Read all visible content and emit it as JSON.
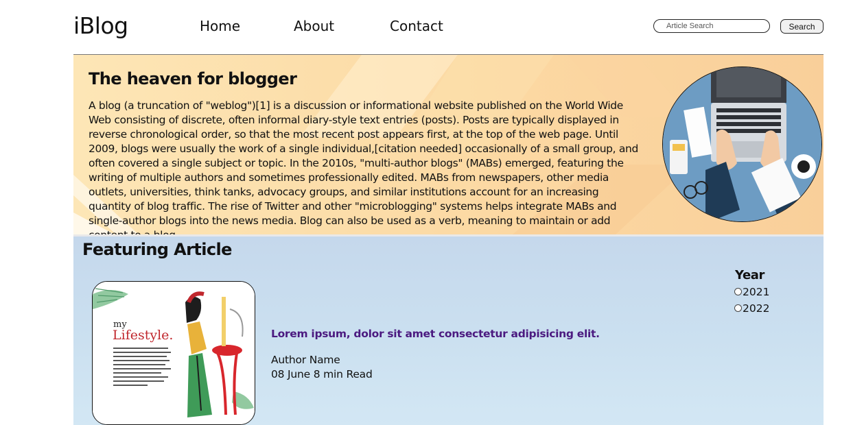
{
  "nav": {
    "logo": "iBlog",
    "links": [
      "Home",
      "About",
      "Contact"
    ],
    "search_placeholder": "Article Search",
    "search_button": "Search"
  },
  "hero": {
    "title": "The heaven for blogger",
    "text": "A blog (a truncation of \"weblog\")[1] is a discussion or informational website published on the World Wide Web consisting of discrete, often informal diary-style text entries (posts). Posts are typically displayed in reverse chronological order, so that the most recent post appears first, at the top of the web page. Until 2009, blogs were usually the work of a single individual,[citation needed] occasionally of a small group, and often covered a single subject or topic. In the 2010s, \"multi-author blogs\" (MABs) emerged, featuring the writing of multiple authors and sometimes professionally edited. MABs from newspapers, other media outlets, universities, think tanks, advocacy groups, and similar institutions account for an increasing quantity of blog traffic. The rise of Twitter and other \"microblogging\" systems helps integrate MABs and single-author blogs into the news media. Blog can also be used as a verb, meaning to maintain or add content to a blog."
  },
  "featured": {
    "heading": "Featuring Article",
    "image_caption": {
      "small": "my",
      "large": "Lifestyle."
    },
    "article_title": "Lorem ipsum, dolor sit amet consectetur adipisicing elit.",
    "author": "Author Name",
    "meta": "08 June 8 min Read"
  },
  "filter": {
    "heading": "Year",
    "options": [
      "2021",
      "2022"
    ]
  },
  "colors": {
    "hero_bg": "#fbd9a2",
    "feature_bg": "#c9dcee",
    "article_link": "#4b1a80"
  }
}
